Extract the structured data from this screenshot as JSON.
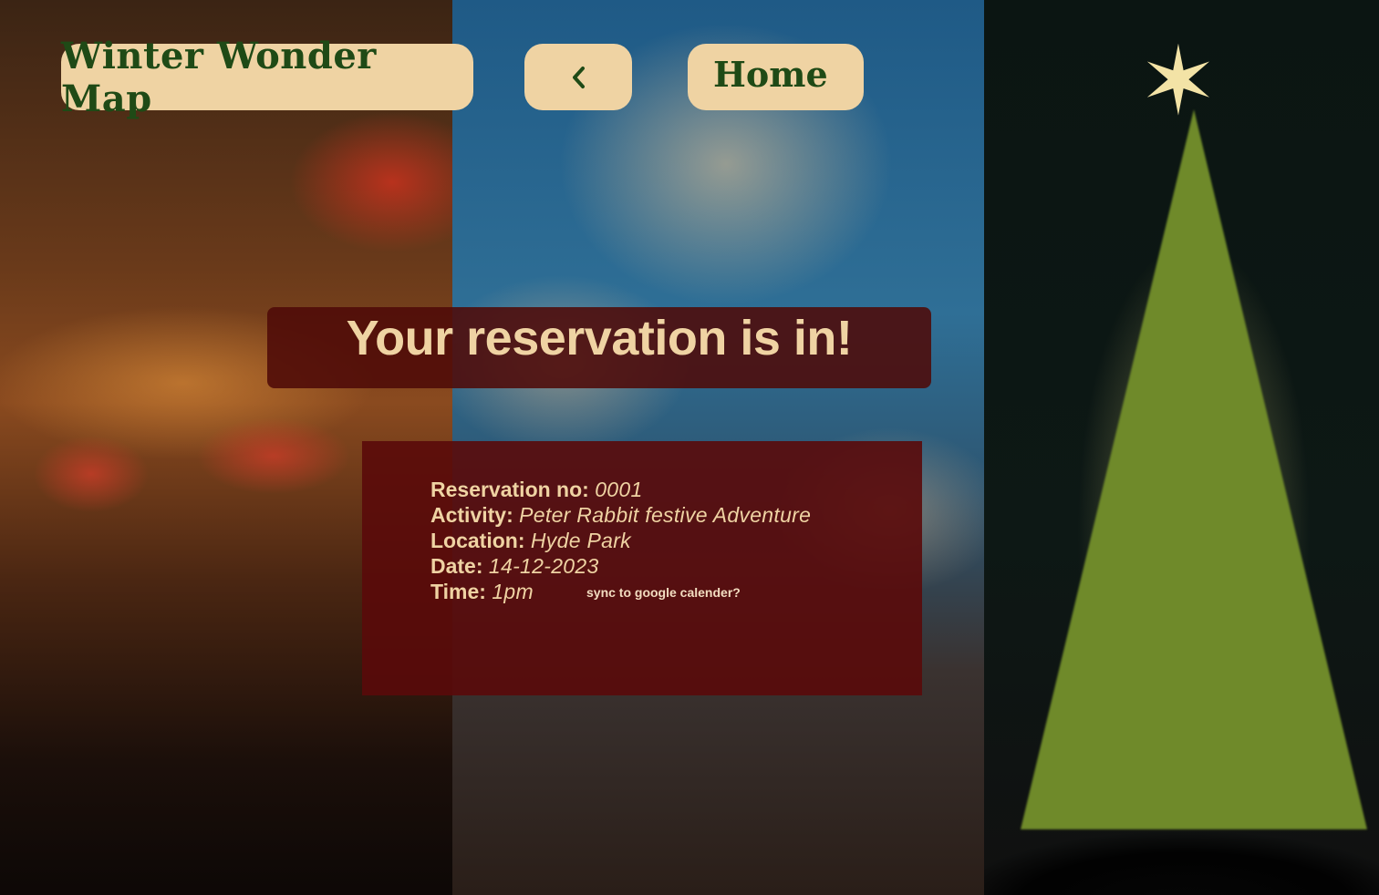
{
  "header": {
    "app_title": "Winter Wonder Map",
    "back_icon": "chevron-left-icon",
    "home_label": "Home"
  },
  "confirmation": {
    "headline": "Your reservation is in!"
  },
  "reservation": {
    "no_label": "Reservation no:",
    "no_value": "0001",
    "activity_label": "Activity:",
    "activity_value": "Peter Rabbit festive Adventure",
    "location_label": "Location:",
    "location_value": "Hyde Park",
    "date_label": "Date:",
    "date_value": "14-12-2023",
    "time_label": "Time:",
    "time_value": "1pm",
    "sync_label": "sync to google calender?"
  },
  "colors": {
    "button_bg": "#efd3a3",
    "button_text": "#1f4a16",
    "overlay_bg": "#5a0a0a",
    "overlay_text": "#efd3a3"
  }
}
